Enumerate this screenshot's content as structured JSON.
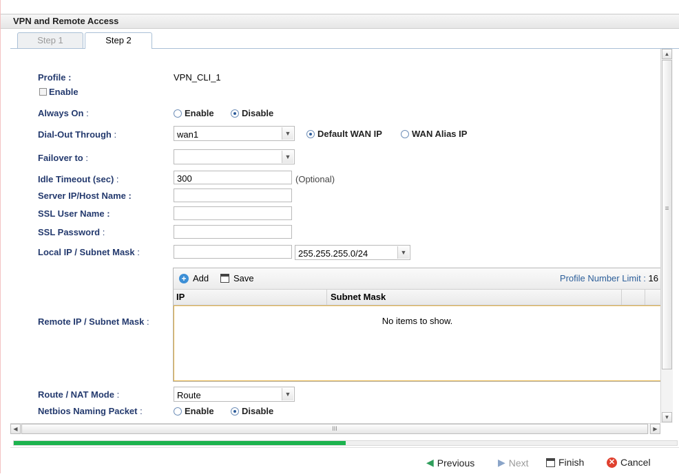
{
  "window": {
    "title": "VPN and Remote Access"
  },
  "tabs": [
    {
      "label": "Step 1",
      "active": false
    },
    {
      "label": "Step 2",
      "active": true
    }
  ],
  "form": {
    "profile": {
      "label": "Profile :",
      "value": "VPN_CLI_1",
      "enable_label": "Enable",
      "enable_checked": false
    },
    "always_on": {
      "label": "Always On",
      "colon": ":",
      "enable": "Enable",
      "disable": "Disable",
      "selected": "Disable"
    },
    "dial_out": {
      "label": "Dial-Out Through",
      "colon": ":",
      "value": "wan1",
      "opt1": "Default WAN IP",
      "opt2": "WAN Alias IP",
      "selected": "Default WAN IP"
    },
    "failover": {
      "label": "Failover to",
      "colon": ":",
      "value": ""
    },
    "idle_timeout": {
      "label": "Idle Timeout (sec)",
      "colon": ":",
      "value": "300",
      "hint": "(Optional)"
    },
    "server_ip": {
      "label": "Server IP/Host Name :",
      "value": ""
    },
    "ssl_user": {
      "label": "SSL User Name :",
      "value": ""
    },
    "ssl_password": {
      "label": "SSL Password",
      "colon": ":",
      "value": ""
    },
    "local_ip": {
      "label": "Local IP / Subnet Mask",
      "colon": ":",
      "value": "",
      "mask": "255.255.255.0/24"
    },
    "remote_ip": {
      "label": "Remote IP / Subnet Mask",
      "colon": ":",
      "add_label": "Add",
      "save_label": "Save",
      "limit_label": "Profile Number Limit :",
      "limit_value": "16",
      "columns": [
        "IP",
        "Subnet Mask"
      ],
      "empty_text": "No items to show."
    },
    "route_nat": {
      "label": "Route / NAT Mode",
      "colon": ":",
      "value": "Route"
    },
    "netbios": {
      "label": "Netbios Naming Packet",
      "colon": ":",
      "enable": "Enable",
      "disable": "Disable",
      "selected": "Disable"
    }
  },
  "scroll": {
    "hscroll_mark": "III",
    "vscroll_mark": "≡"
  },
  "progress": {
    "fraction": 0.5
  },
  "footer": {
    "previous": "Previous",
    "next": "Next",
    "finish": "Finish",
    "cancel": "Cancel"
  },
  "colors": {
    "label": "#243a6e",
    "progress": "#1cb34e",
    "grid_body_border": "#e6b445"
  }
}
